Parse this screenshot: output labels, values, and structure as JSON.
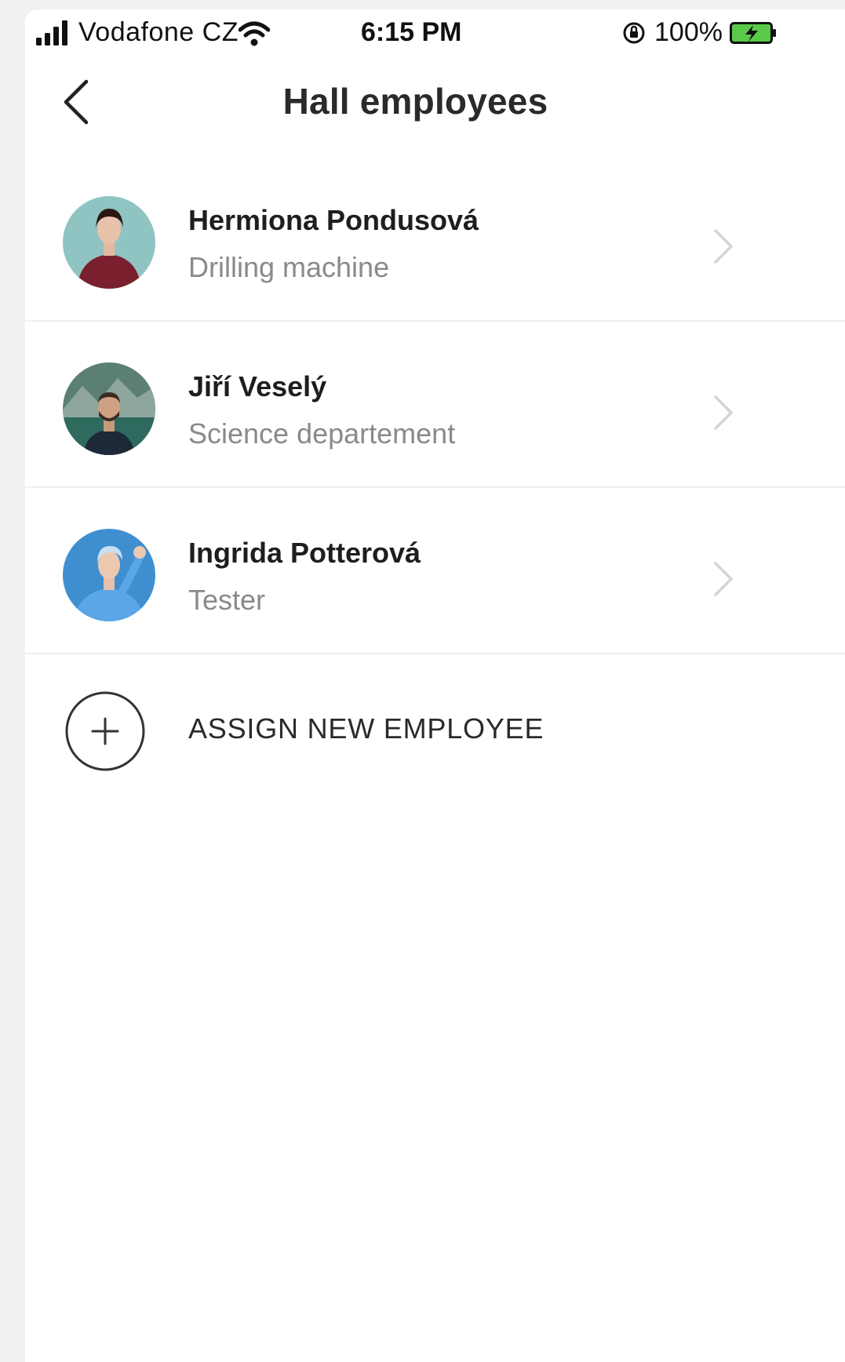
{
  "status_bar": {
    "carrier": "Vodafone CZ",
    "time": "6:15 PM",
    "battery": "100%"
  },
  "nav": {
    "title": "Hall employees",
    "back_icon": "chevron-left-icon"
  },
  "employees": [
    {
      "name": "Hermiona Pondusová",
      "role": "Drilling machine"
    },
    {
      "name": "Jiří Veselý",
      "role": "Science departement"
    },
    {
      "name": "Ingrida Potterová",
      "role": "Tester"
    }
  ],
  "assign": {
    "label": "ASSIGN NEW EMPLOYEE",
    "icon": "plus-circle-icon"
  },
  "colors": {
    "battery": "#5ac94a",
    "text_primary": "#1e1e1e",
    "text_secondary": "#8a8a8a",
    "divider": "#f0f0f0"
  }
}
